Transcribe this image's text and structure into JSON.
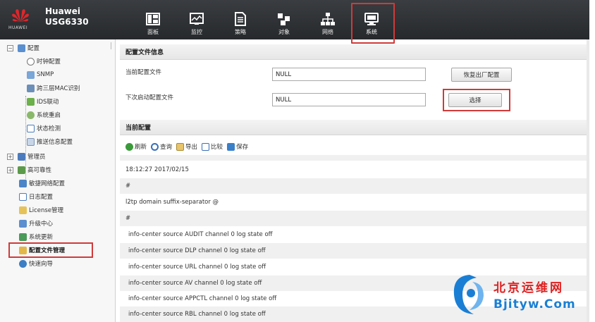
{
  "brand": {
    "logo_text": "HUAWEI",
    "product_line1": "Huawei",
    "product_line2": "USG6330"
  },
  "nav": {
    "tabs": [
      {
        "label": "面板",
        "icon": "dashboard-icon"
      },
      {
        "label": "监控",
        "icon": "monitor-icon"
      },
      {
        "label": "策略",
        "icon": "policy-icon"
      },
      {
        "label": "对象",
        "icon": "object-icon"
      },
      {
        "label": "网络",
        "icon": "network-icon"
      },
      {
        "label": "系统",
        "icon": "system-icon",
        "active": true
      }
    ]
  },
  "sidebar": {
    "items": [
      {
        "label": "配置",
        "expander": "⊟",
        "icon": "config-icon"
      },
      {
        "label": "时钟配置",
        "icon": "clock-icon"
      },
      {
        "label": "SNMP",
        "icon": "snmp-icon"
      },
      {
        "label": "跨三层MAC识别",
        "icon": "mac-icon"
      },
      {
        "label": "IDS联动",
        "icon": "ids-icon"
      },
      {
        "label": "系统重启",
        "icon": "restart-icon"
      },
      {
        "label": "状态检测",
        "icon": "status-check-icon"
      },
      {
        "label": "推送信息配置",
        "icon": "push-info-icon"
      },
      {
        "label": "管理员",
        "expander": "⊞",
        "icon": "admin-icon"
      },
      {
        "label": "高可靠性",
        "expander": "⊞",
        "icon": "ha-icon"
      },
      {
        "label": "敏捷网络配置",
        "icon": "agile-network-icon"
      },
      {
        "label": "日志配置",
        "icon": "log-icon"
      },
      {
        "label": "License管理",
        "icon": "license-icon"
      },
      {
        "label": "升级中心",
        "icon": "upgrade-icon"
      },
      {
        "label": "系统更新",
        "icon": "update-icon"
      },
      {
        "label": "配置文件管理",
        "icon": "config-file-icon",
        "selected": true
      },
      {
        "label": "快速向导",
        "icon": "wizard-icon"
      }
    ]
  },
  "config_file_info": {
    "title": "配置文件信息",
    "current_label": "当前配置文件",
    "current_value": "NULL",
    "next_label": "下次启动配置文件",
    "next_value": "NULL",
    "restore_button": "恢复出厂配置",
    "select_button": "选择"
  },
  "current_config": {
    "title": "当前配置",
    "toolbar": {
      "refresh": "刷新",
      "query": "查询",
      "export": "导出",
      "compare": "比较",
      "save": "保存"
    },
    "lines": [
      "18:12:27  2017/02/15",
      "#",
      " l2tp  domain  suffix-separator  @",
      "#",
      " info-center  source  AUDIT  channel  0  log  state  off",
      " info-center  source  DLP  channel  0  log  state  off",
      " info-center  source  URL  channel  0  log  state  off",
      " info-center  source  AV  channel  0  log  state  off",
      " info-center  source  APPCTL  channel  0  log  state  off",
      " info-center  source  RBL  channel  0  log  state  off"
    ]
  },
  "watermark": {
    "cn": "北京运维网",
    "en": "Bjityw.Com"
  },
  "colors": {
    "highlight": "#d13a3a",
    "topbar": "#2e3135",
    "watermark_red": "#e02020",
    "watermark_blue": "#1a7fd4"
  }
}
